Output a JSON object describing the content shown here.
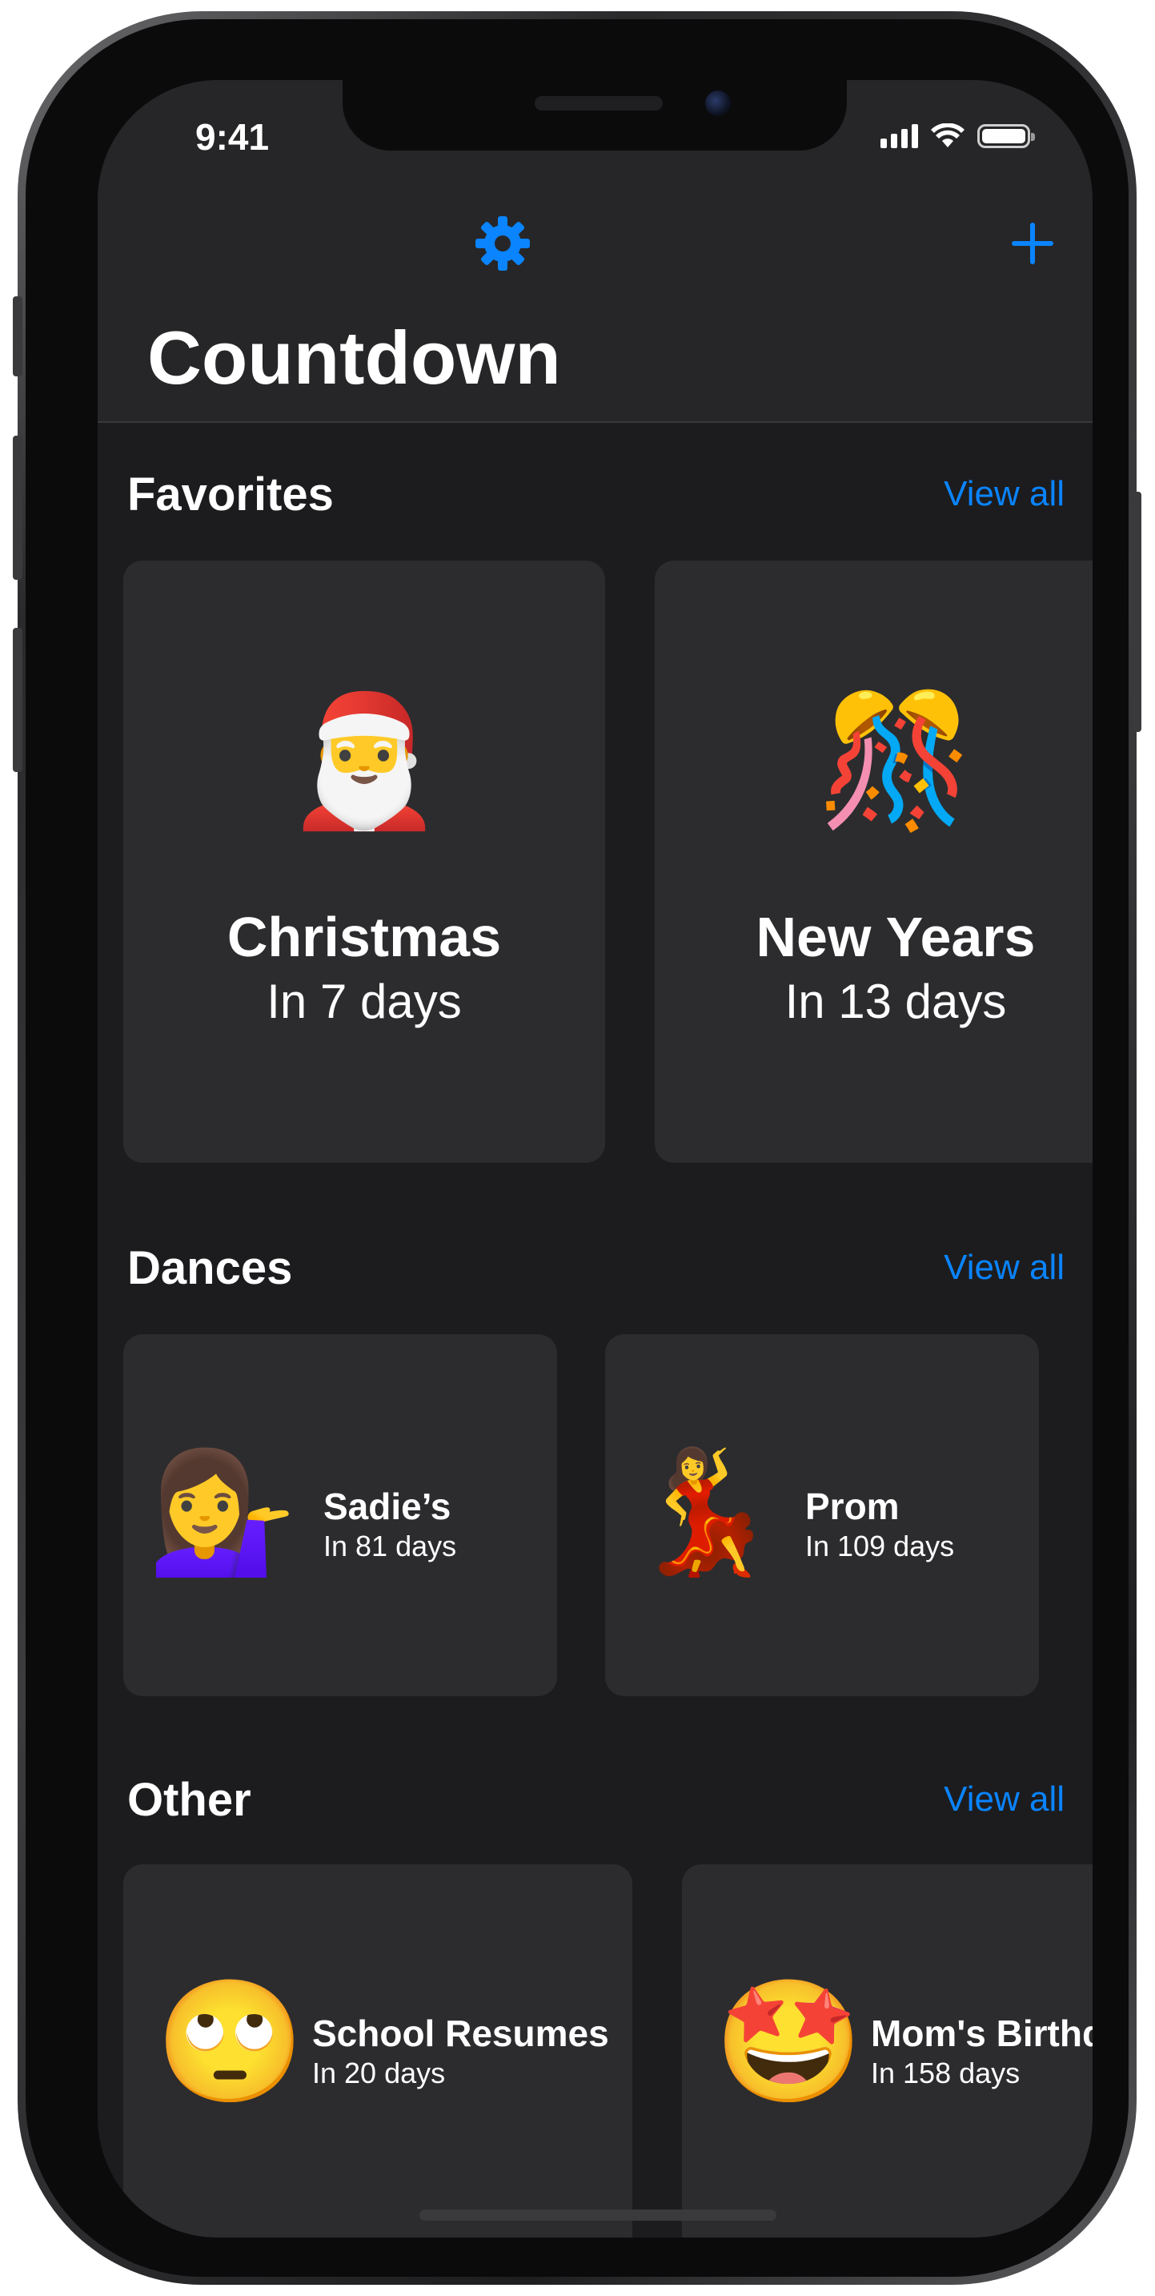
{
  "status_bar": {
    "time": "9:41"
  },
  "nav": {
    "title": "Countdown",
    "settings_icon": "gear-icon",
    "add_icon": "plus-icon",
    "accent_color": "#0a84ff"
  },
  "sections": {
    "favorites": {
      "title": "Favorites",
      "view_all": "View all",
      "items": [
        {
          "emoji": "🎅",
          "title": "Christmas",
          "subtitle": "In 7 days"
        },
        {
          "emoji": "🎊",
          "title": "New Years",
          "subtitle": "In 13 days"
        }
      ]
    },
    "dances": {
      "title": "Dances",
      "view_all": "View all",
      "items": [
        {
          "emoji": "💁‍♀️",
          "title": "Sadie’s",
          "subtitle": "In 81 days"
        },
        {
          "emoji": "💃",
          "title": "Prom",
          "subtitle": "In 109 days"
        }
      ]
    },
    "other": {
      "title": "Other",
      "view_all": "View all",
      "items": [
        {
          "emoji": "🙄",
          "title": "School Resumes",
          "subtitle": "In 20 days"
        },
        {
          "emoji": "🤩",
          "title": "Mom's Birthd",
          "subtitle": "In 158 days"
        }
      ]
    }
  },
  "colors": {
    "background": "#1c1c1e",
    "card": "#2c2c2e",
    "nav_background": "#262628",
    "link": "#0a84ff"
  }
}
